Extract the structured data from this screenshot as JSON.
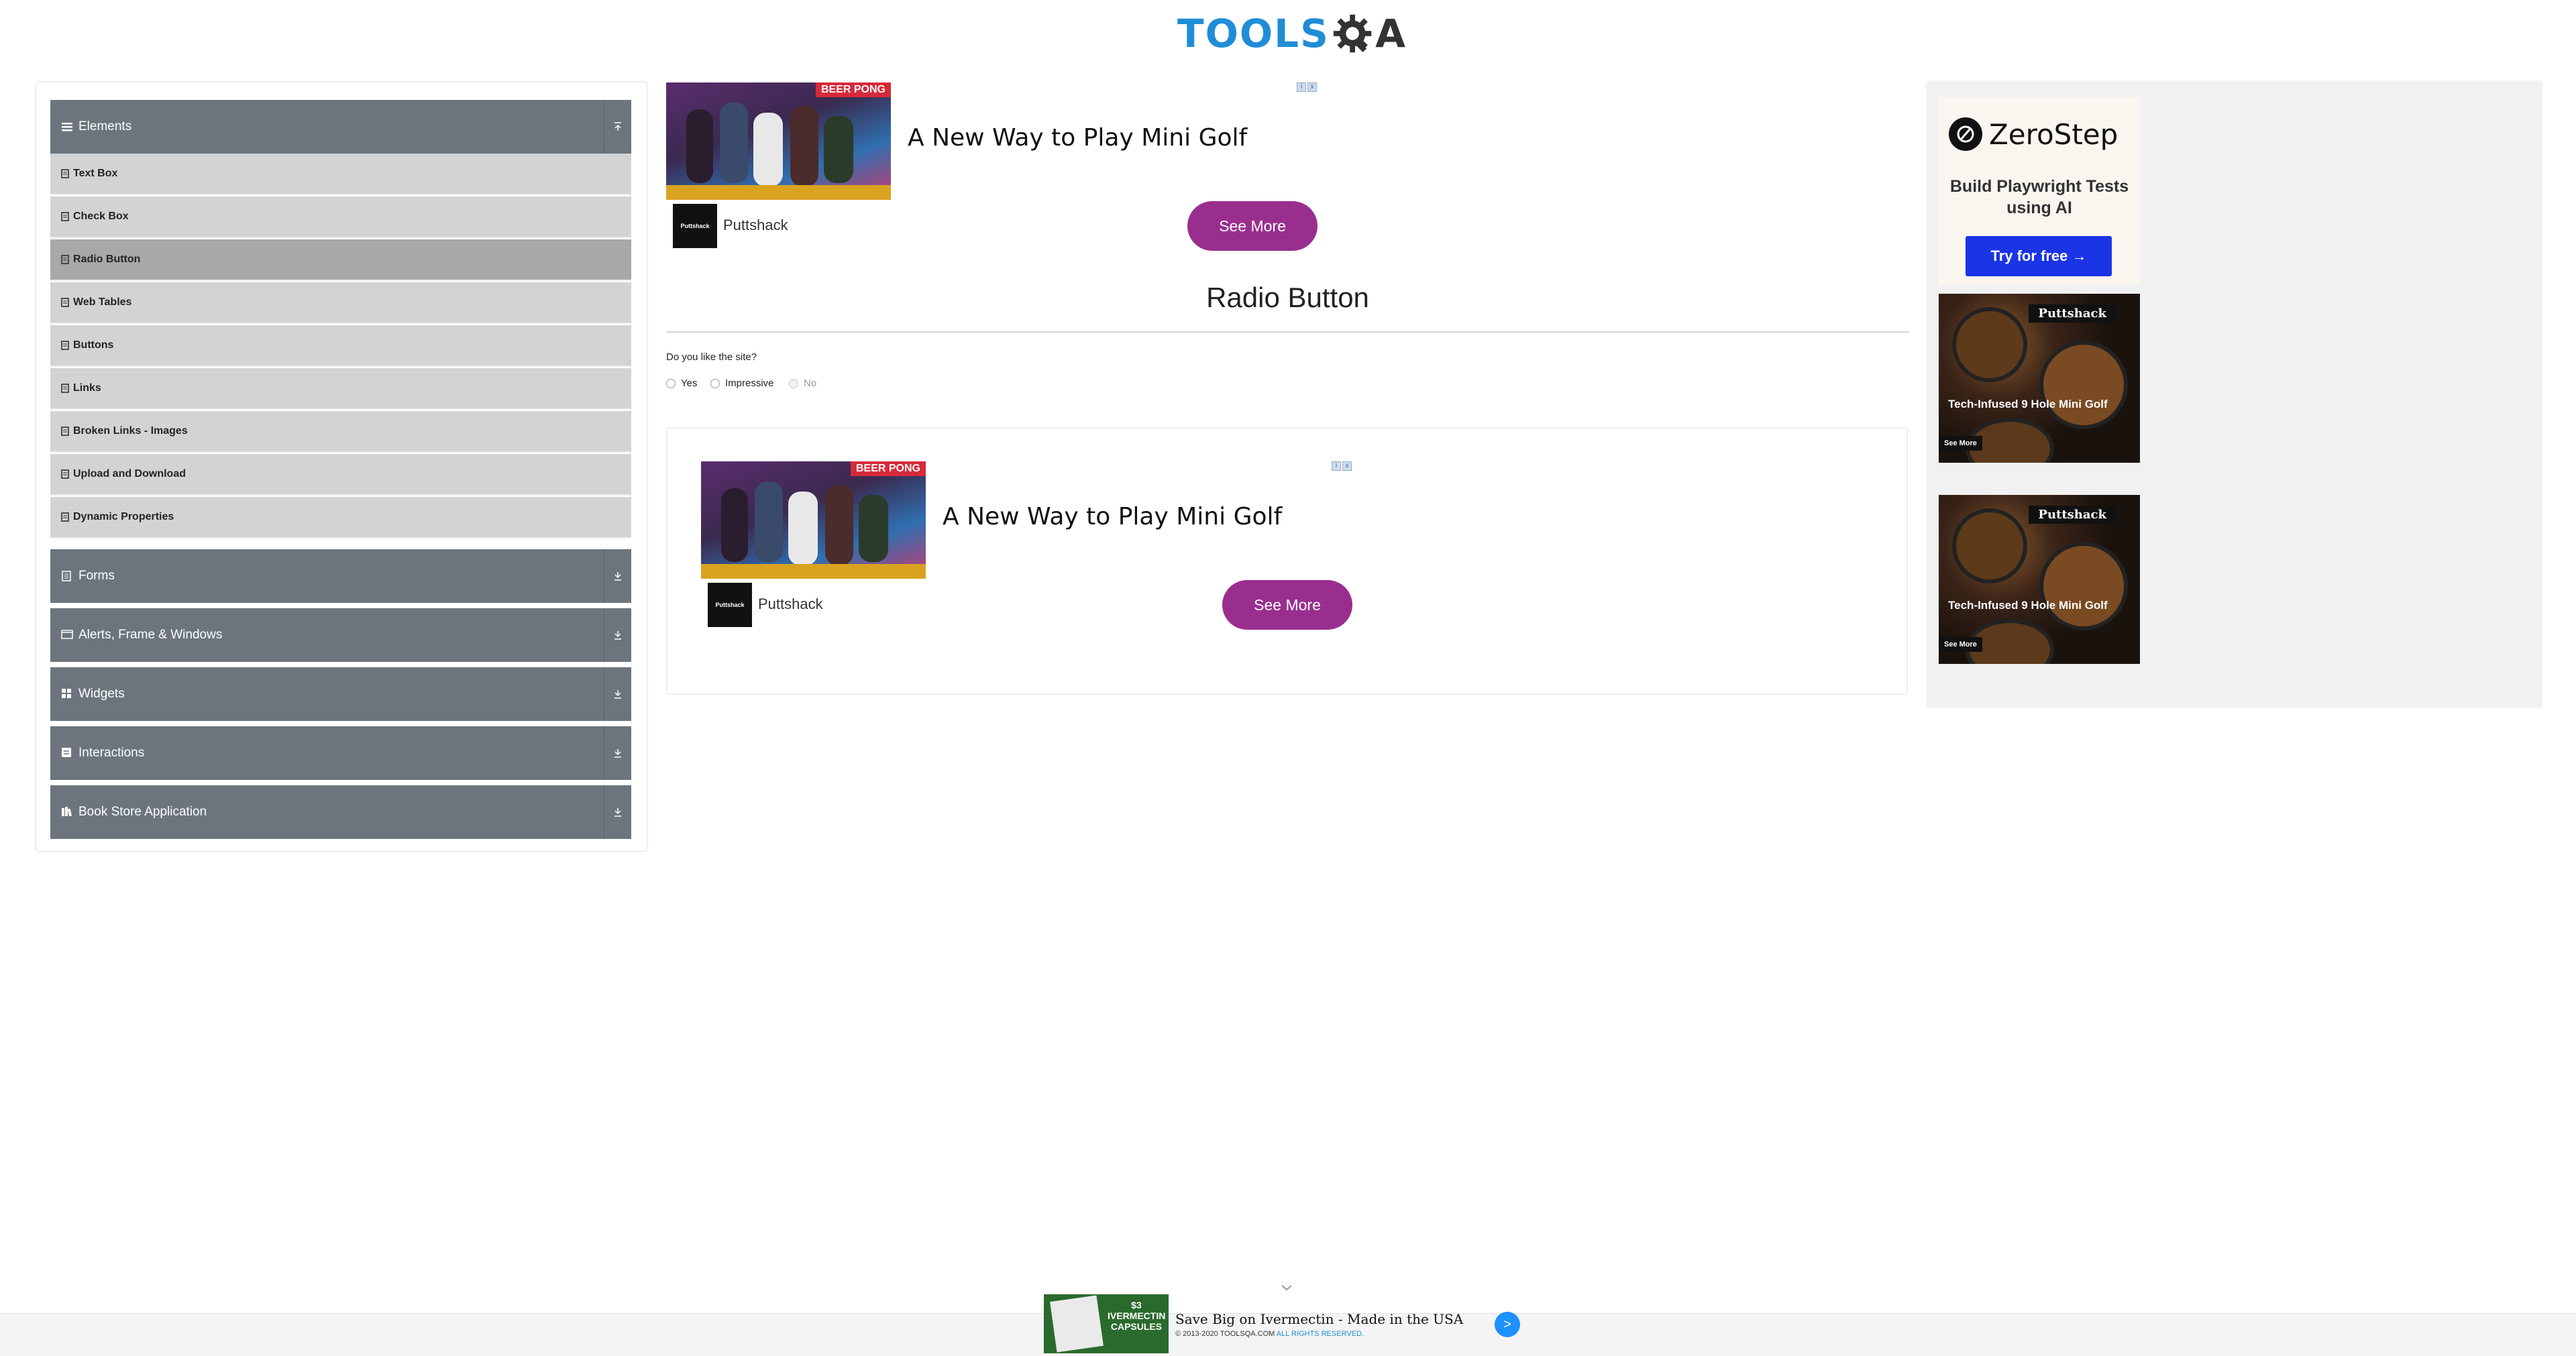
{
  "header": {
    "logo_text": "TOOLS",
    "logo_suffix": "A"
  },
  "sidebar": {
    "groups": [
      {
        "title": "Elements",
        "expanded": true,
        "items": [
          {
            "label": "Text Box"
          },
          {
            "label": "Check Box"
          },
          {
            "label": "Radio Button",
            "active": true
          },
          {
            "label": "Web Tables"
          },
          {
            "label": "Buttons"
          },
          {
            "label": "Links"
          },
          {
            "label": "Broken Links - Images"
          },
          {
            "label": "Upload and Download"
          },
          {
            "label": "Dynamic Properties"
          }
        ]
      },
      {
        "title": "Forms"
      },
      {
        "title": "Alerts, Frame & Windows"
      },
      {
        "title": "Widgets"
      },
      {
        "title": "Interactions"
      },
      {
        "title": "Book Store Application"
      }
    ]
  },
  "top_ad": {
    "headline": "A New Way to Play Mini Golf",
    "brand": "Puttshack",
    "brand_logo": "Puttshack",
    "button": "See More",
    "sign": "BEER PONG"
  },
  "main": {
    "title": "Radio Button",
    "question": "Do you like the site?",
    "options": [
      {
        "label": "Yes",
        "disabled": false
      },
      {
        "label": "Impressive",
        "disabled": false
      },
      {
        "label": "No",
        "disabled": true
      }
    ]
  },
  "inline_ad": {
    "headline": "A New Way to Play Mini Golf",
    "brand": "Puttshack",
    "brand_logo": "Puttshack",
    "button": "See More",
    "sign": "BEER PONG"
  },
  "right_ad": {
    "brand": "ZeroStep",
    "tagline": "Build Playwright Tests using AI",
    "button": "Try for free →",
    "food_ads": [
      {
        "brand": "Puttshack",
        "text": "Tech-Infused 9 Hole Mini Golf",
        "more": "See More"
      },
      {
        "brand": "Puttshack",
        "text": "Tech-Infused 9 Hole Mini Golf",
        "more": "See More"
      }
    ]
  },
  "footer": {
    "ad_text": "Save Big on Ivermectin - Made in the USA",
    "ad_image_label": "$3 IVERMECTIN CAPSULES",
    "copyright_prefix": "© 2013-2020 TOOLSQA.COM",
    "copyright_suffix": "ALL RIGHTS RESERVED.",
    "arrow": ">"
  },
  "colors": {
    "accent": "#1f8dd6",
    "menu_group": "#6c757d",
    "menu_item": "#d3d3d3",
    "menu_active": "#a8a8a8",
    "ad_button": "#9a2e8f",
    "zerostep_button": "#1b34e6"
  }
}
